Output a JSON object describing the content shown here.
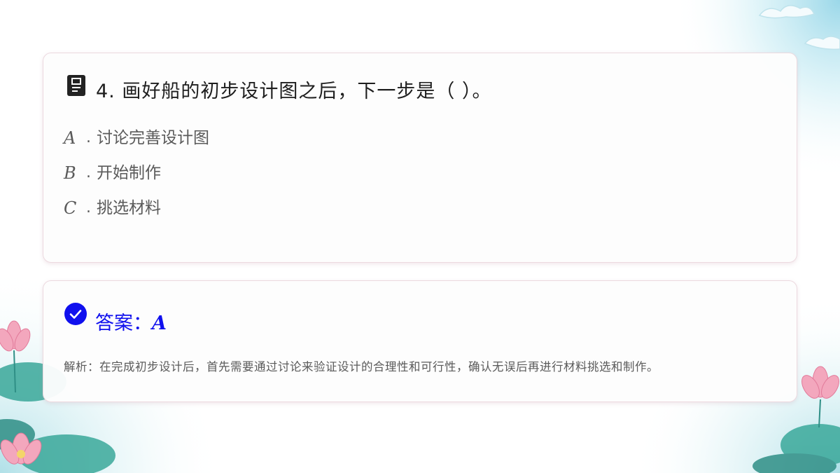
{
  "question": {
    "number": "4.",
    "text": "画好船的初步设计图之后，下一步是（ ）。",
    "options": [
      {
        "letter": "A",
        "text": "讨论完善设计图"
      },
      {
        "letter": "B",
        "text": "开始制作"
      },
      {
        "letter": "C",
        "text": "挑选材料"
      }
    ]
  },
  "answer": {
    "label": "答案：",
    "value": "A",
    "explanation": "解析：在完成初步设计后，首先需要通过讨论来验证设计的合理性和可行性，确认无误后再进行材料挑选和制作。"
  },
  "colors": {
    "answer_accent": "#1010ee",
    "card_border": "#ecd9df",
    "lotus_pink": "#f3a7bd",
    "lotus_leaf": "#3aa89a"
  },
  "icons": {
    "question": "document-icon",
    "answer": "check-circle-icon"
  }
}
